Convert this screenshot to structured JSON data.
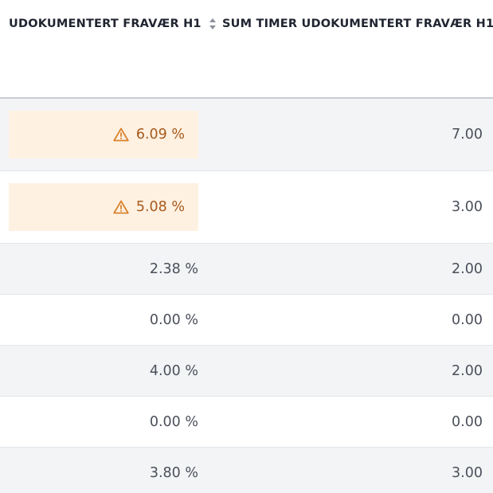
{
  "columns": [
    {
      "label": "UDOKUMENTERT FRAVÆR H1",
      "sort_icon": "sort-icon"
    },
    {
      "label": "SUM TIMER UDOKUMENTERT FRAVÆR H1",
      "sort_icon": "sort-icon"
    }
  ],
  "rows": [
    {
      "percent": "6.09 %",
      "hours": "7.00",
      "warning": true
    },
    {
      "percent": "5.08 %",
      "hours": "3.00",
      "warning": true
    },
    {
      "percent": "2.38 %",
      "hours": "2.00",
      "warning": false
    },
    {
      "percent": "0.00 %",
      "hours": "0.00",
      "warning": false
    },
    {
      "percent": "4.00 %",
      "hours": "2.00",
      "warning": false
    },
    {
      "percent": "0.00 %",
      "hours": "0.00",
      "warning": false
    },
    {
      "percent": "3.80 %",
      "hours": "3.00",
      "warning": false
    }
  ],
  "colors": {
    "warning_bg": "#fff1e2",
    "warning_text": "#a65a1c",
    "warning_icon": "#d9822b",
    "row_alt": "#f3f4f6"
  },
  "icons": {
    "warning": "warning-triangle-icon"
  }
}
